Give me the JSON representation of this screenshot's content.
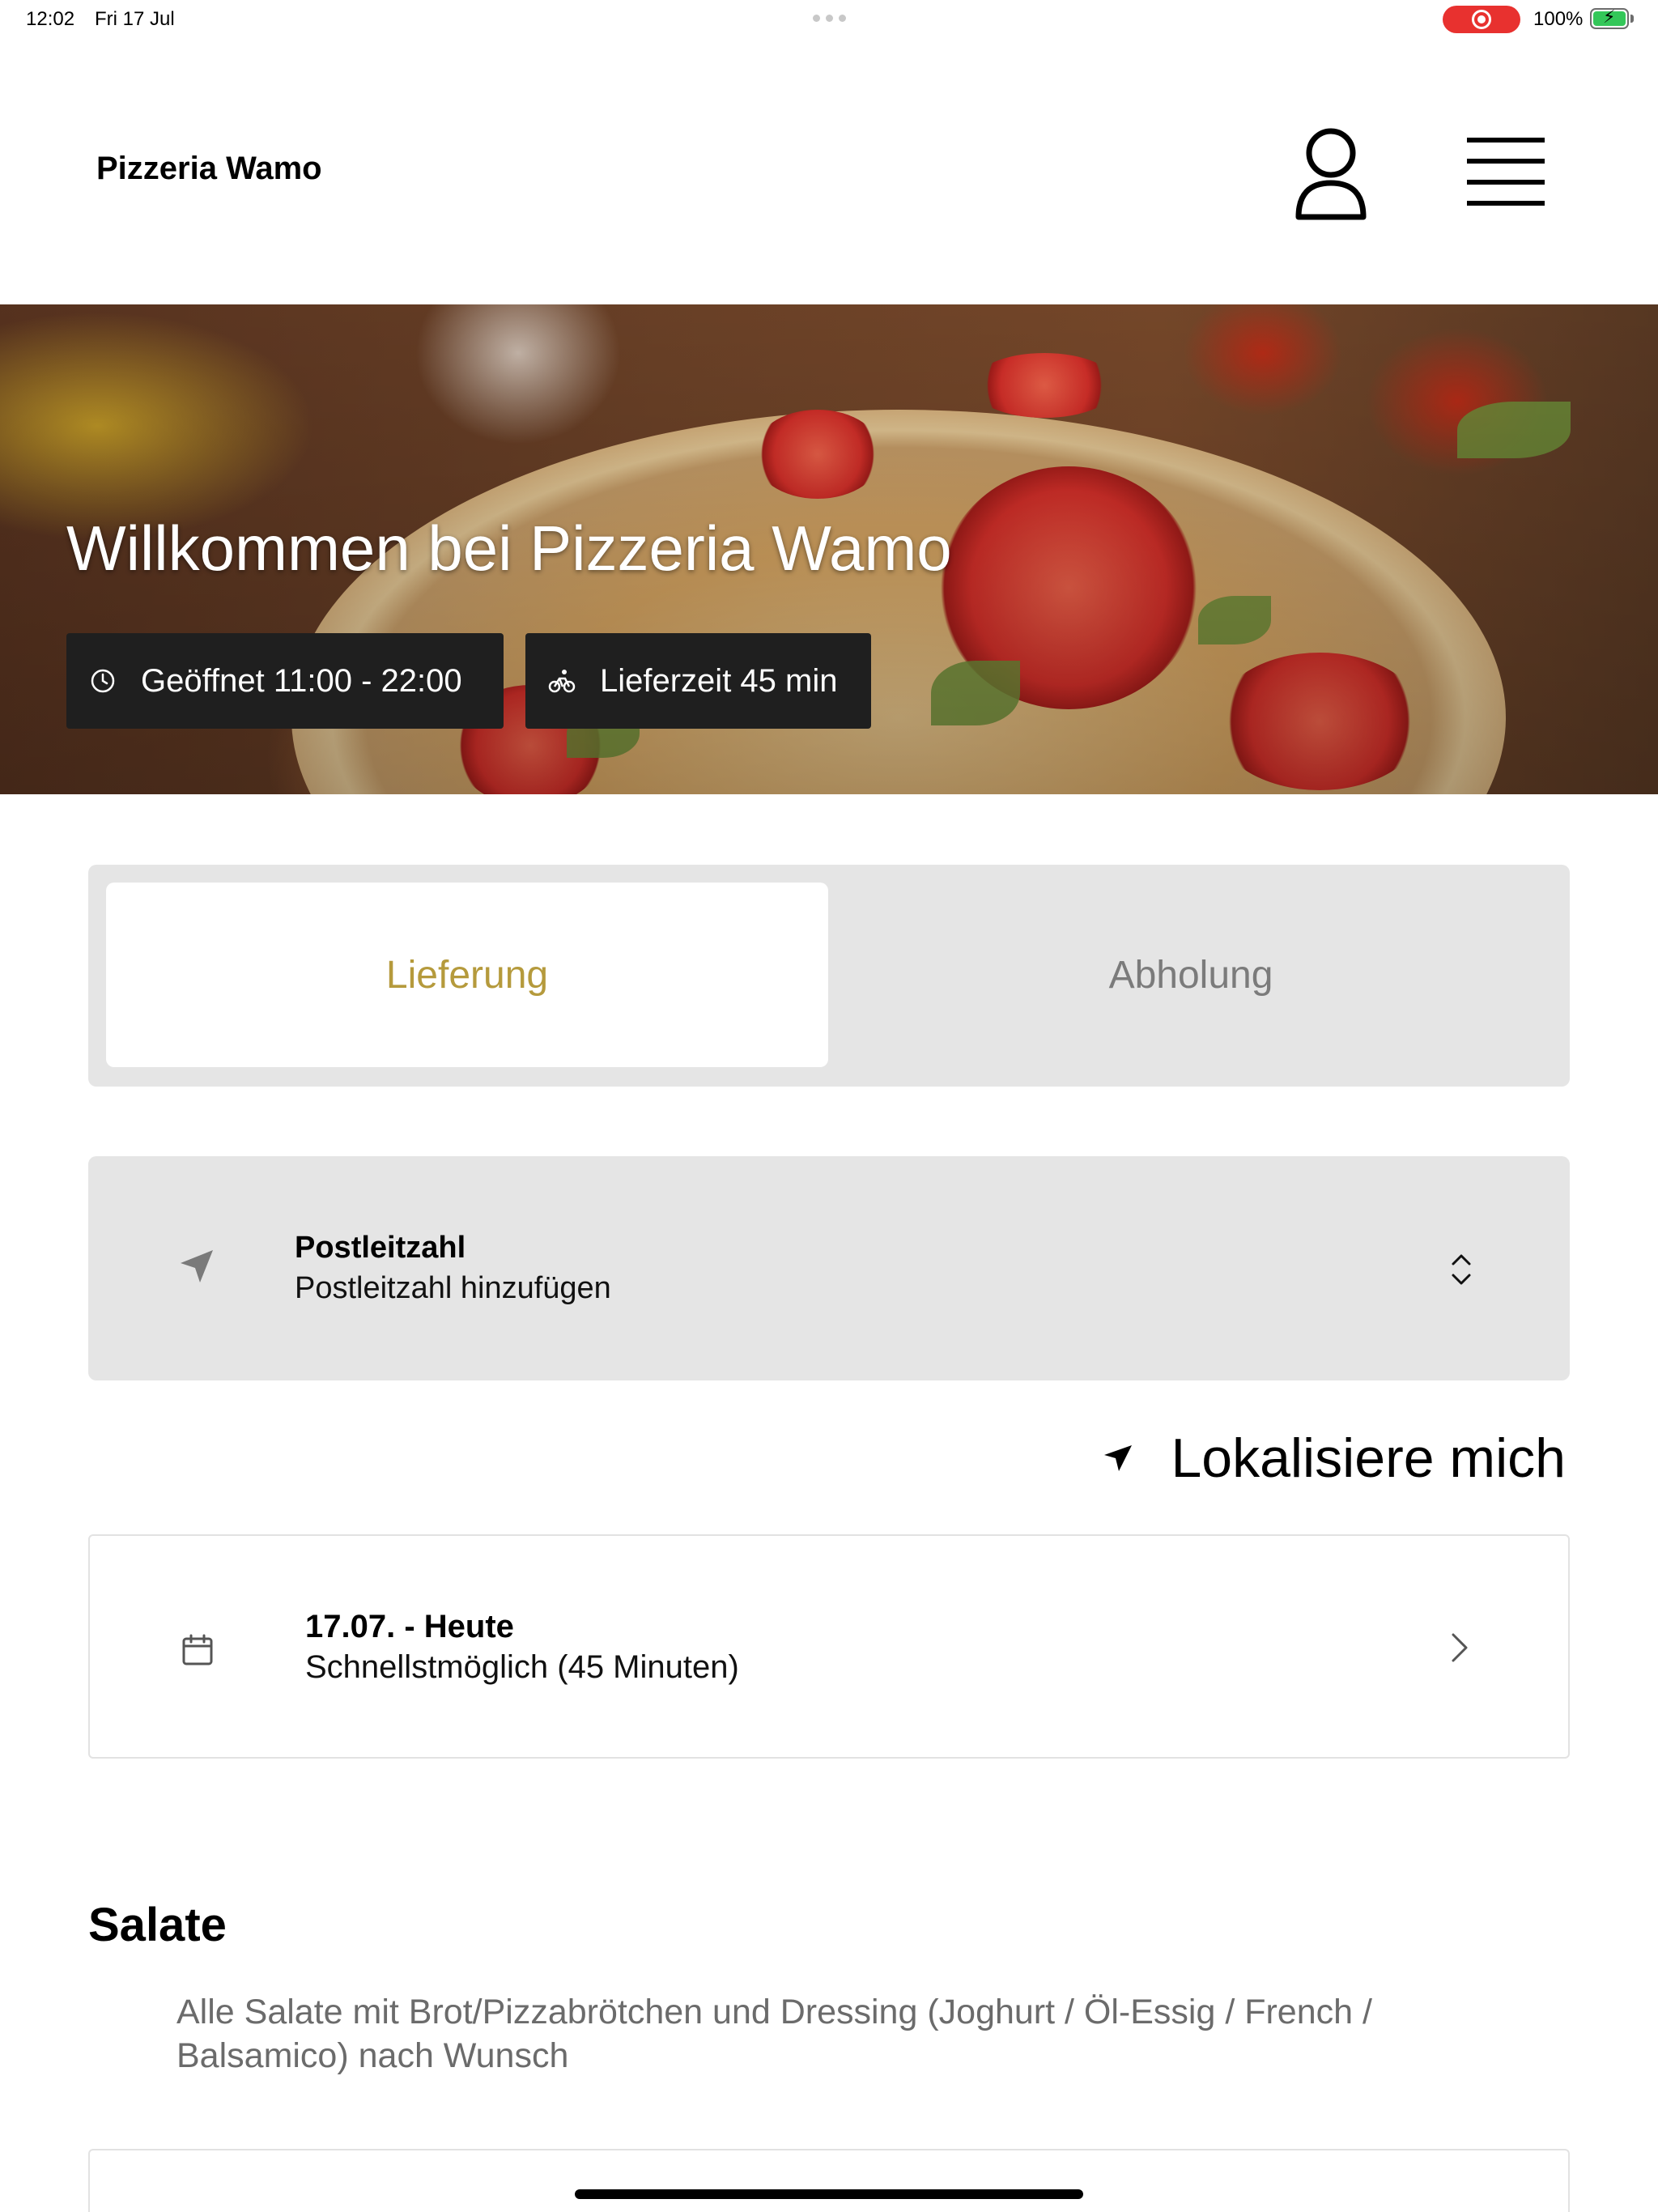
{
  "status_bar": {
    "time": "12:02",
    "date": "Fri 17 Jul",
    "battery_percent": "100%",
    "recording_color": "#e8312f",
    "battery_color": "#34c759"
  },
  "header": {
    "brand": "Pizzeria Wamo",
    "account_icon": "user-icon",
    "menu_icon": "hamburger-menu-icon"
  },
  "hero": {
    "title": "Willkommen bei Pizzeria Wamo",
    "opening_hours": "Geöffnet 11:00 - 22:00",
    "delivery_time": "Lieferzeit 45 min",
    "opening_icon": "clock-icon",
    "delivery_icon": "bicycle-icon"
  },
  "order_mode": {
    "tabs": [
      {
        "label": "Lieferung",
        "active": true
      },
      {
        "label": "Abholung",
        "active": false
      }
    ],
    "active_color": "#b59a3c"
  },
  "postal_code": {
    "title": "Postleitzahl",
    "placeholder": "Postleitzahl hinzufügen",
    "icon": "location-arrow-icon",
    "chevron_icon": "chevron-up-down-icon"
  },
  "localize": {
    "label": "Lokalisiere mich",
    "icon": "location-arrow-icon"
  },
  "delivery_date": {
    "title": "17.07. - Heute",
    "subtitle": "Schnellstmöglich (45 Minuten)",
    "icon": "calendar-icon",
    "arrow_icon": "chevron-right-icon"
  },
  "menu_section": {
    "title": "Salate",
    "description": "Alle Salate mit Brot/Pizzabrötchen und Dressing (Joghurt / Öl-Essig / French / Balsamico) nach Wunsch"
  }
}
